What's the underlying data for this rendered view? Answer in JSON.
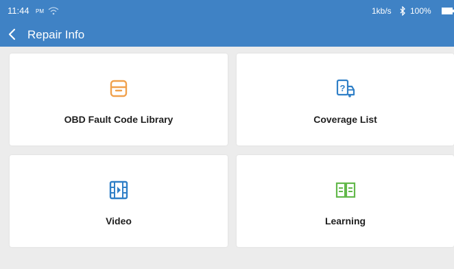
{
  "status_bar": {
    "time": "11:44",
    "ampm": "PM",
    "network_rate": "1kb/s",
    "battery": "100%"
  },
  "header": {
    "title": "Repair Info"
  },
  "colors": {
    "header_bg": "#3f82c5",
    "page_bg": "#ececec",
    "obd_icon": "#f0a04b",
    "coverage_icon": "#2f7fc7",
    "video_icon": "#2f7fc7",
    "learning_icon": "#62b84a"
  },
  "cards": [
    {
      "label": "OBD Fault Code Library",
      "icon": "archive-box-icon"
    },
    {
      "label": "Coverage List",
      "icon": "vehicle-coverage-icon"
    },
    {
      "label": "Video",
      "icon": "film-strip-icon"
    },
    {
      "label": "Learning",
      "icon": "open-book-icon"
    }
  ]
}
